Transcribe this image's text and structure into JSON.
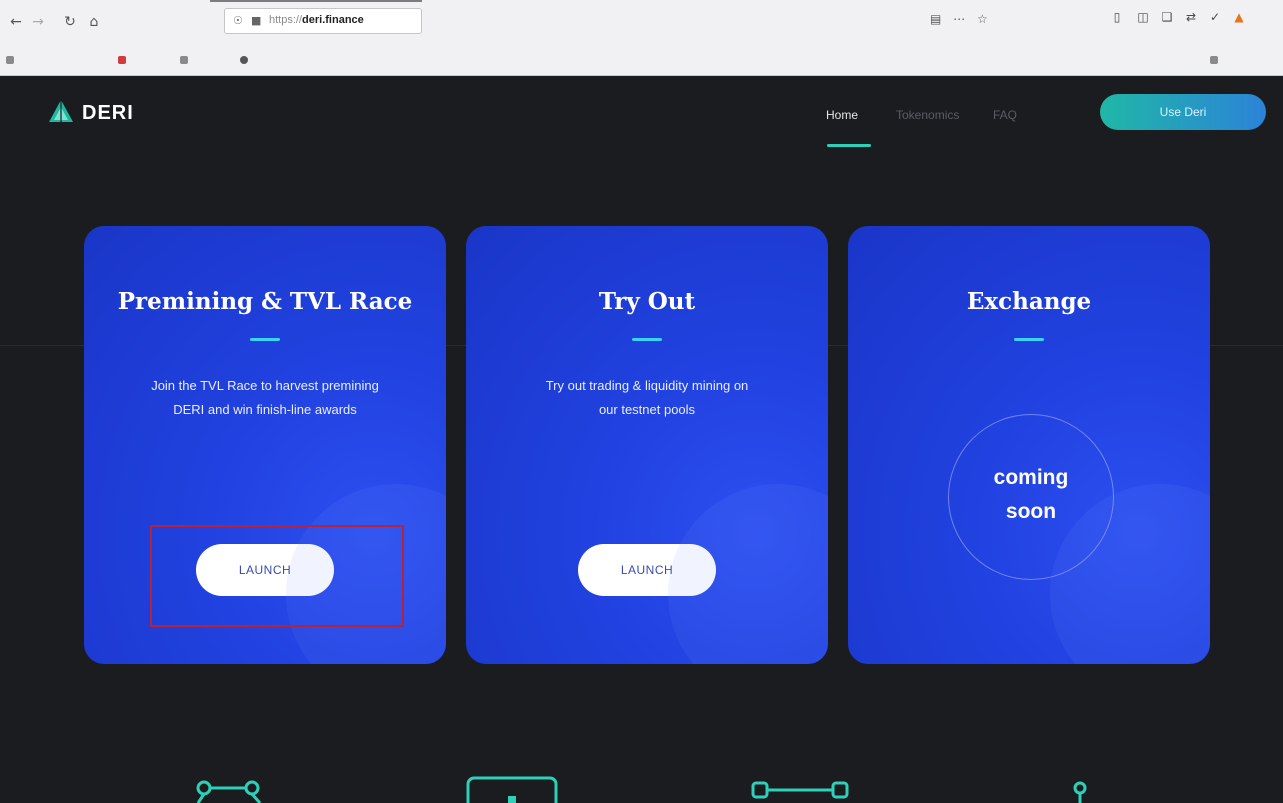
{
  "browser": {
    "nav_icons": [
      "back-icon",
      "forward-icon",
      "reload-icon",
      "home-icon"
    ],
    "url": {
      "scheme": "https://",
      "host": "deri.finance"
    },
    "page_action_icons": [
      "reader-view-icon",
      "more-actions-icon",
      "bookmark-star-icon"
    ],
    "extension_icons": [
      "library-icon",
      "sidebar-icon",
      "screenshot-icon",
      "sync-icon",
      "pocket-icon",
      "metamask-icon"
    ],
    "bookmarks": []
  },
  "site": {
    "logo_text": "DERI",
    "nav": [
      {
        "label": "Home",
        "active": true
      },
      {
        "label": "Tokenomics",
        "active": false
      },
      {
        "label": "FAQ",
        "active": false
      }
    ],
    "header_button": "Use Deri",
    "accent_color": "#2ed1b8"
  },
  "cards": [
    {
      "title": "Premining & TVL Race",
      "desc_line1": "Join the TVL Race to harvest premining",
      "desc_line2": "DERI and win finish-line awards",
      "button": "LAUNCH"
    },
    {
      "title": "Try Out",
      "desc_line1": "Try out trading & liquidity mining on",
      "desc_line2": "our testnet pools",
      "button": "LAUNCH"
    },
    {
      "title": "Exchange",
      "soon_line1": "coming",
      "soon_line2": "soon"
    }
  ],
  "feature_icons": [
    "network-node-icon",
    "monitor-icon",
    "chain-link-icon",
    "location-pin-icon"
  ]
}
